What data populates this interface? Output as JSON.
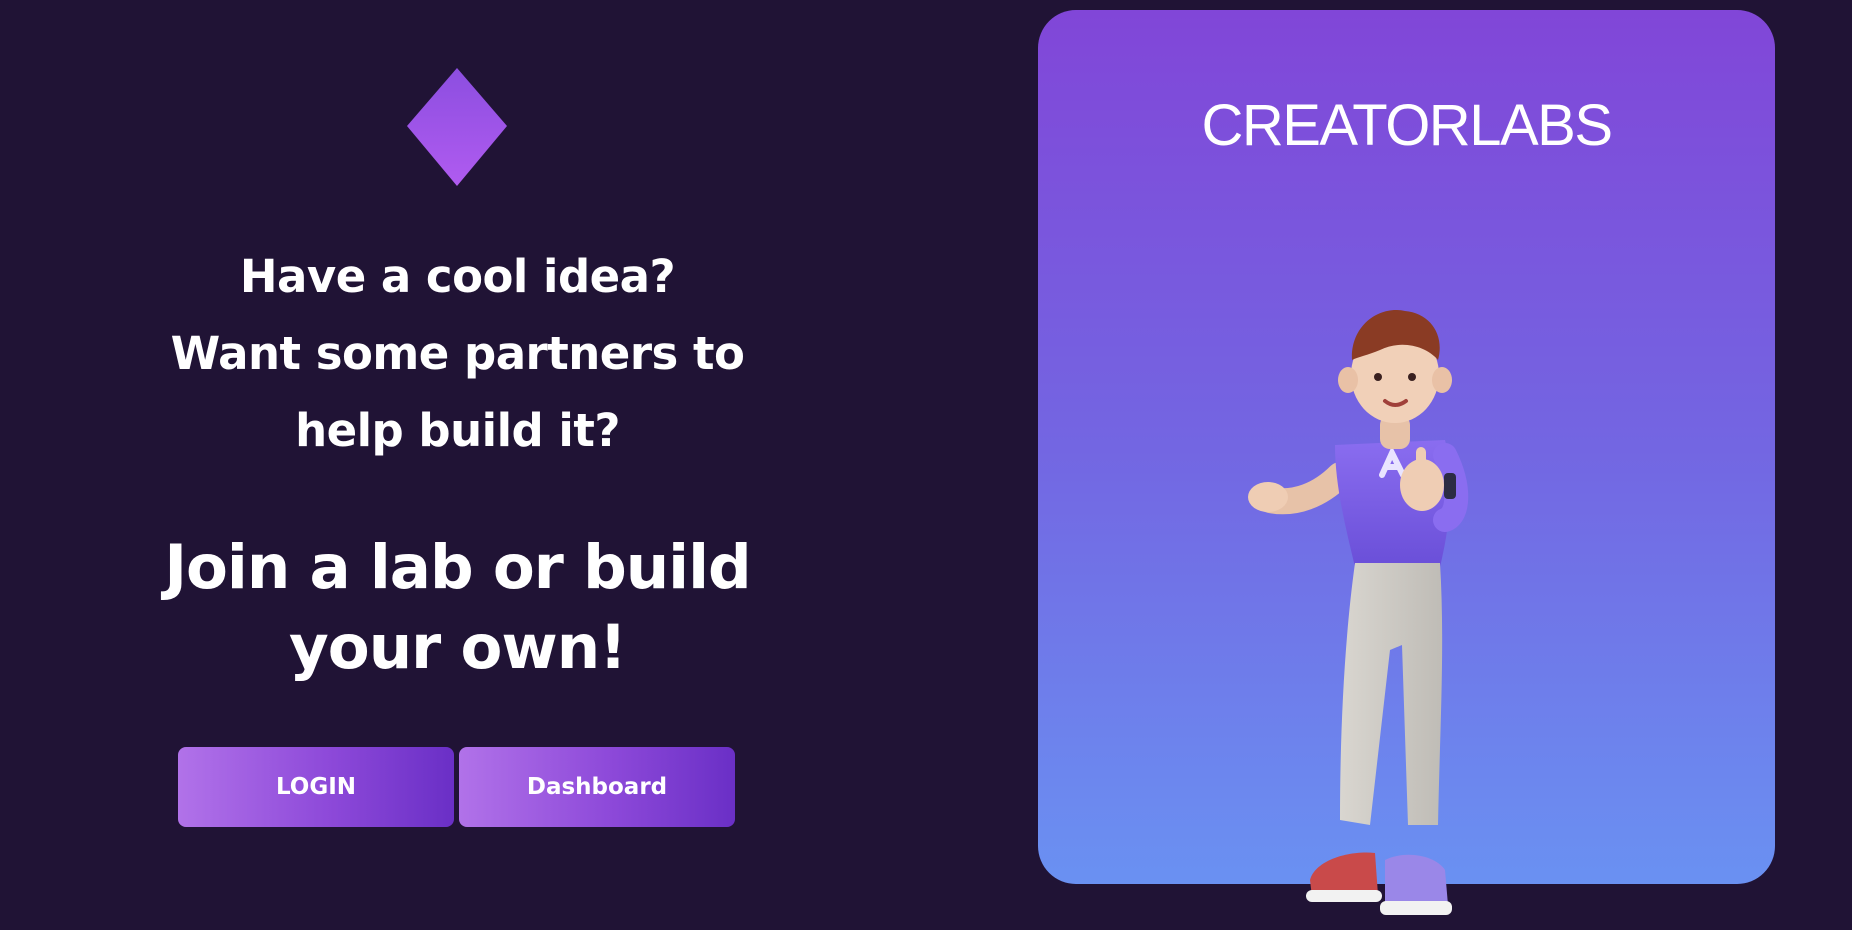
{
  "intro": {
    "lines": [
      "Have a cool idea?",
      "Want some partners to",
      "help build it?"
    ]
  },
  "headline": {
    "lines": [
      "Join a lab or build",
      "your own!"
    ]
  },
  "buttons": {
    "login_label": "LOGIN",
    "dashboard_label": "Dashboard"
  },
  "card": {
    "title": "CREATORLABS",
    "illustration_icon": "character-illustration"
  },
  "logo_icon": "diamond-logo-icon",
  "colors": {
    "background": "#201335",
    "accent": "#8d49d9",
    "card_top": "#8146d8",
    "card_bottom": "#6a91f2"
  }
}
